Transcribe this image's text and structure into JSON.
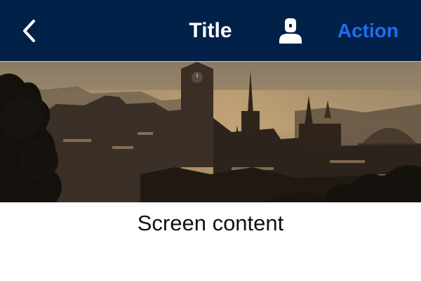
{
  "navbar": {
    "title": "Title",
    "action_label": "Action",
    "back_icon": "chevron-left-icon",
    "profile_icon": "person-icon",
    "background_color": "#022149",
    "action_color": "#1e6ff0"
  },
  "hero": {
    "image_subject": "city-skyline-photo"
  },
  "content": {
    "text": "Screen content"
  }
}
